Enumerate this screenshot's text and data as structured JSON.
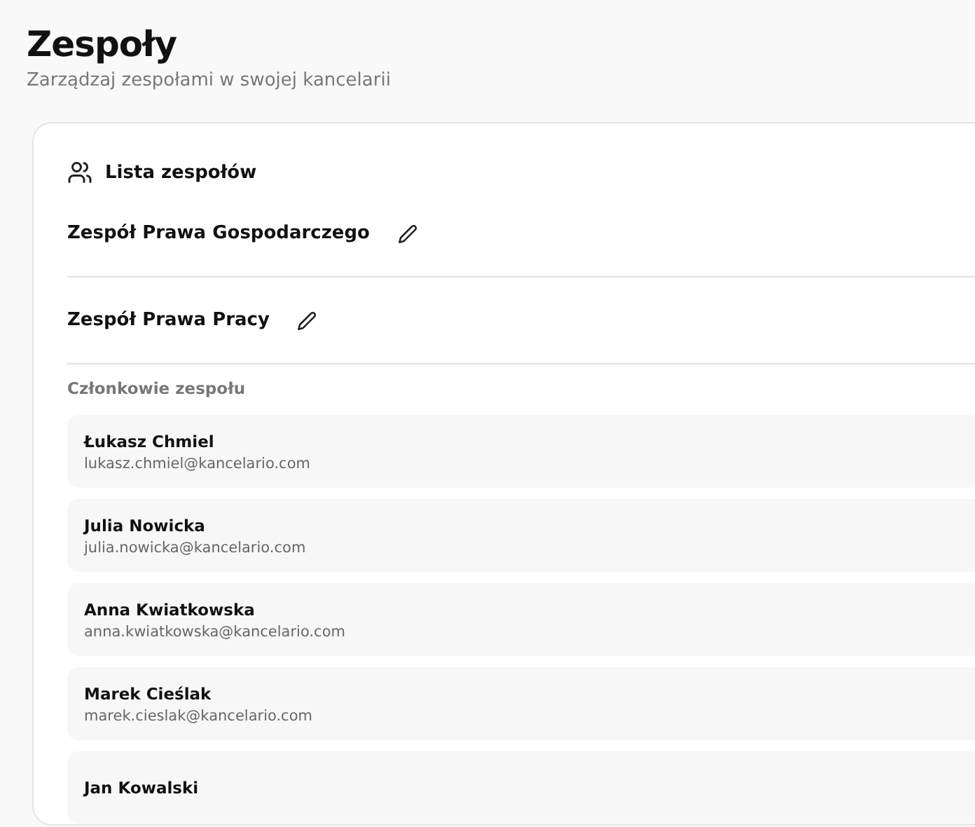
{
  "header": {
    "title": "Zespoły",
    "subtitle": "Zarządzaj zespołami w swojej kancelarii"
  },
  "card": {
    "title": "Lista zespołów",
    "teams": [
      {
        "name": "Zespół Prawa Gospodarczego"
      },
      {
        "name": "Zespół Prawa Pracy",
        "members_label": "Członkowie zespołu",
        "members": [
          {
            "name": "Łukasz Chmiel",
            "email": "lukasz.chmiel@kancelario.com"
          },
          {
            "name": "Julia Nowicka",
            "email": "julia.nowicka@kancelario.com"
          },
          {
            "name": "Anna Kwiatkowska",
            "email": "anna.kwiatkowska@kancelario.com"
          },
          {
            "name": "Marek Cieślak",
            "email": "marek.cieslak@kancelario.com"
          },
          {
            "name": "Jan Kowalski"
          }
        ]
      }
    ]
  }
}
